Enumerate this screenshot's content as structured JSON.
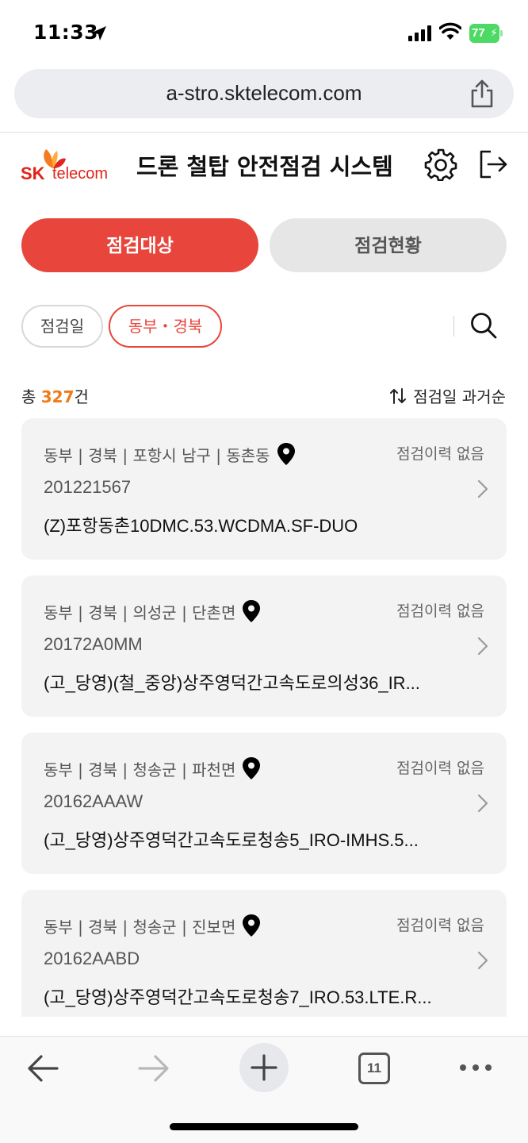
{
  "status_bar": {
    "time": "11:33",
    "battery": "77"
  },
  "browser": {
    "url": "a-stro.sktelecom.com",
    "tab_count": "11"
  },
  "header": {
    "logo_sk": "SK",
    "logo_telecom": "telecom",
    "title": "드론 철탑 안전점검 시스템"
  },
  "segments": {
    "active_label": "점검대상",
    "inactive_label": "점검현황"
  },
  "filters": {
    "date_chip": "점검일",
    "region_chip": "동부・경북"
  },
  "summary": {
    "total_prefix": "총 ",
    "total_count": "327",
    "total_suffix": "건",
    "sort_label": "점검일 과거순"
  },
  "items": [
    {
      "region": "동부 | 경북 | 포항시 남구 | 동촌동",
      "history": "점검이력 없음",
      "id": "201221567",
      "name": "(Z)포항동촌10DMC.53.WCDMA.SF-DUO"
    },
    {
      "region": "동부 | 경북 | 의성군 | 단촌면",
      "history": "점검이력 없음",
      "id": "20172A0MM",
      "name": "(고_당영)(철_중앙)상주영덕간고속도로의성36_IR..."
    },
    {
      "region": "동부 | 경북 | 청송군 | 파천면",
      "history": "점검이력 없음",
      "id": "20162AAAW",
      "name": "(고_당영)상주영덕간고속도로청송5_IRO-IMHS.5..."
    },
    {
      "region": "동부 | 경북 | 청송군 | 진보면",
      "history": "점검이력 없음",
      "id": "20162AABD",
      "name": "(고_당영)상주영덕간고속도로청송7_IRO.53.LTE.R..."
    }
  ],
  "colors": {
    "accent": "#e8453c",
    "count": "#f07a18",
    "brand": "#e2231a"
  },
  "icons": [
    "location-arrow-icon",
    "signal-icon",
    "wifi-icon",
    "battery-icon",
    "share-icon",
    "gear-icon",
    "logout-icon",
    "search-icon",
    "sort-icon",
    "pin-icon",
    "chevron-right-icon",
    "back-icon",
    "forward-icon",
    "plus-icon",
    "tabs-icon",
    "more-icon"
  ]
}
